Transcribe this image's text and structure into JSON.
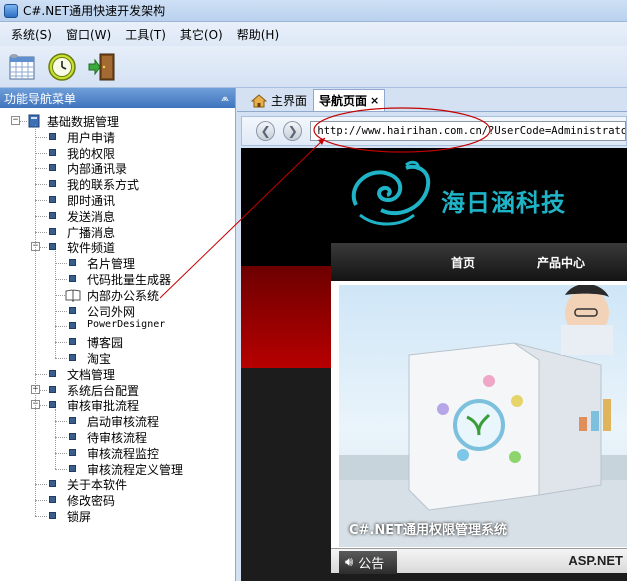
{
  "window": {
    "title": "C#.NET通用快速开发架构"
  },
  "menu": [
    {
      "label": "系统(S)"
    },
    {
      "label": "窗口(W)"
    },
    {
      "label": "工具(T)"
    },
    {
      "label": "其它(O)"
    },
    {
      "label": "帮助(H)"
    }
  ],
  "toolbar": {
    "icons": [
      "calendar-grid-icon",
      "clock-icon",
      "exit-door-icon"
    ]
  },
  "nav_panel": {
    "title": "功能导航菜单",
    "tree": [
      {
        "label": "基础数据管理",
        "level": 0,
        "expander": "-",
        "icon": "folder-book-icon"
      },
      {
        "label": "用户申请",
        "level": 1,
        "icon": "node-icon"
      },
      {
        "label": "我的权限",
        "level": 1,
        "icon": "node-icon"
      },
      {
        "label": "内部通讯录",
        "level": 1,
        "icon": "node-icon"
      },
      {
        "label": "我的联系方式",
        "level": 1,
        "icon": "node-icon"
      },
      {
        "label": "即时通讯",
        "level": 1,
        "icon": "node-icon"
      },
      {
        "label": "发送消息",
        "level": 1,
        "icon": "node-icon"
      },
      {
        "label": "广播消息",
        "level": 1,
        "icon": "node-icon"
      },
      {
        "label": "软件频道",
        "level": 1,
        "expander": "-",
        "icon": "node-icon"
      },
      {
        "label": "名片管理",
        "level": 2,
        "icon": "node-icon"
      },
      {
        "label": "代码批量生成器",
        "level": 2,
        "icon": "node-icon"
      },
      {
        "label": "内部办公系统",
        "level": 2,
        "icon": "open-book-icon"
      },
      {
        "label": "公司外网",
        "level": 2,
        "icon": "node-icon"
      },
      {
        "label": "PowerDesigner",
        "level": 2,
        "icon": "node-icon"
      },
      {
        "label": "博客园",
        "level": 2,
        "icon": "node-icon"
      },
      {
        "label": "淘宝",
        "level": 2,
        "icon": "node-icon"
      },
      {
        "label": "文档管理",
        "level": 1,
        "icon": "node-icon"
      },
      {
        "label": "系统后台配置",
        "level": 1,
        "expander": "+",
        "icon": "node-icon"
      },
      {
        "label": "审核审批流程",
        "level": 1,
        "expander": "-",
        "icon": "node-icon"
      },
      {
        "label": "启动审核流程",
        "level": 2,
        "icon": "node-icon"
      },
      {
        "label": "待审核流程",
        "level": 2,
        "icon": "node-icon"
      },
      {
        "label": "审核流程监控",
        "level": 2,
        "icon": "node-icon"
      },
      {
        "label": "审核流程定义管理",
        "level": 2,
        "icon": "node-icon"
      },
      {
        "label": "关于本软件",
        "level": 1,
        "icon": "node-icon"
      },
      {
        "label": "修改密码",
        "level": 1,
        "icon": "node-icon"
      },
      {
        "label": "锁屏",
        "level": 1,
        "icon": "node-icon"
      }
    ]
  },
  "tabs": [
    {
      "label": "主界面",
      "icon": "home-icon",
      "active": false
    },
    {
      "label": "导航页面",
      "active": true,
      "close": "×"
    }
  ],
  "browser": {
    "url": "http://www.hairihan.com.cn/?UserCode=Administrator&"
  },
  "website": {
    "brand": "海日涵科技",
    "nav": [
      "首页",
      "产品中心"
    ],
    "banner_caption": "C#.NET通用权限管理系统",
    "notice_label": "公告",
    "footer_brand": "ASP.NET"
  },
  "colors": {
    "panel_header": "#3f74bd",
    "annotation": "#c40000",
    "brand": "#1fb3c7",
    "tree_node": "#3a5e8c"
  }
}
